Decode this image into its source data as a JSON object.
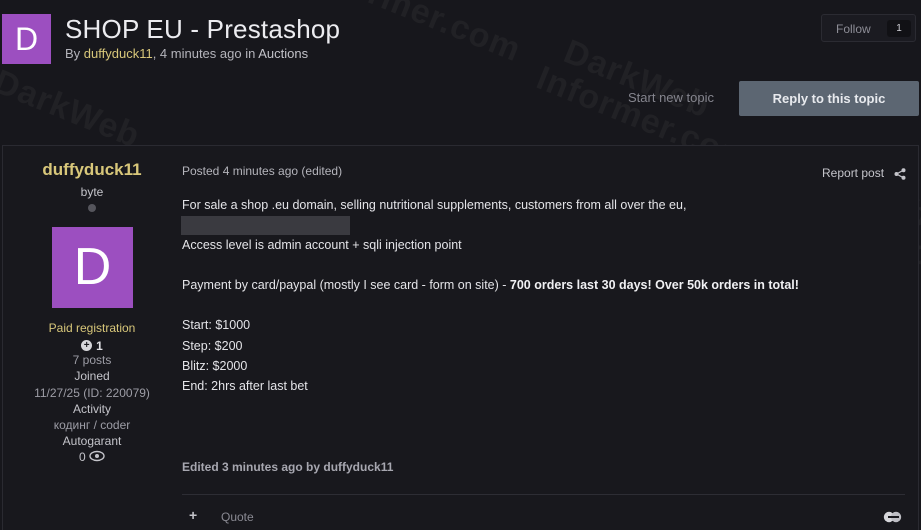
{
  "topic": {
    "avatar_letter": "D",
    "title": "SHOP EU - Prestashop",
    "meta_by": "By ",
    "meta_author": "duffyduck11",
    "meta_time": ", 4 minutes ago in ",
    "meta_forum": "Auctions"
  },
  "actions": {
    "follow_label": "Follow",
    "follow_count": "1",
    "start_new_topic": "Start new topic",
    "reply": "Reply to this topic"
  },
  "author": {
    "name": "duffyduck11",
    "rank": "byte",
    "avatar_letter": "D",
    "group": "Paid registration",
    "reputation": "1",
    "posts": "7 posts",
    "joined_label": "Joined",
    "joined_value": "11/27/25  (ID: 220079)",
    "activity_label": "Activity",
    "activity_value": "кодинг / coder",
    "autogarant_label": "Autogarant",
    "autogarant_value": "0"
  },
  "post": {
    "date": "Posted 4 minutes ago (edited)",
    "report": "Report post",
    "line1": "For sale a shop .eu domain, selling nutritional supplements, customers from all over the eu,",
    "line2": "Access level is admin account + sqli injection point",
    "line3_prefix": "Payment by card/paypal (mostly I see card - form on site) - ",
    "line3_bold": "700 orders last 30 days! Over 50k orders in total!",
    "start": "Start: $1000",
    "step": "Step: $200",
    "blitz": "Blitz: $2000",
    "end": "End: 2hrs after last bet",
    "edited": "Edited 3 minutes ago by duffyduck11",
    "quote": "Quote"
  },
  "watermark": {
    "line1": "DarkWeb",
    "line2": "Informer.com"
  },
  "colors": {
    "accent_gold": "#d8c77a",
    "avatar_purple": "#9c4fc0",
    "reply_button": "#5c6672"
  }
}
